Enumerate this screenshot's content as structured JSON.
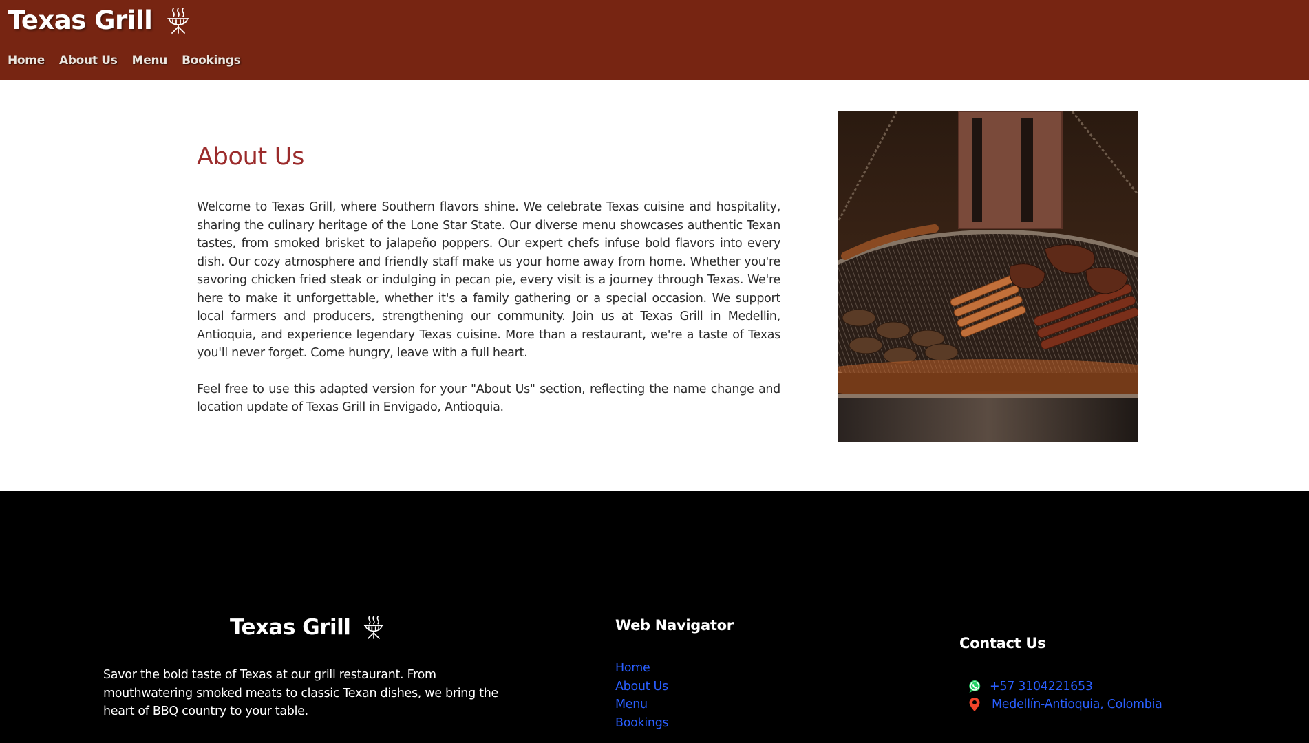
{
  "header": {
    "brand_title": "Texas Grill",
    "brand_icon": "grill-icon",
    "nav": [
      {
        "label": "Home"
      },
      {
        "label": "About Us"
      },
      {
        "label": "Menu"
      },
      {
        "label": "Bookings"
      }
    ],
    "background_color": "#772512"
  },
  "about": {
    "heading": "About Us",
    "paragraphs": [
      "Welcome to Texas Grill, where Southern flavors shine. We celebrate Texas cuisine and hospitality, sharing the culinary heritage of the Lone Star State. Our diverse menu showcases authentic Texan tastes, from smoked brisket to jalapeño poppers. Our expert chefs infuse bold flavors into every dish. Our cozy atmosphere and friendly staff make us your home away from home. Whether you're savoring chicken fried steak or indulging in pecan pie, every visit is a journey through Texas. We're here to make it unforgettable, whether it's a family gathering or a special occasion. We support local farmers and producers, strengthening our community. Join us at Texas Grill in Medellin, Antioquia, and experience legendary Texas cuisine. More than a restaurant, we're a taste of Texas you'll never forget. Come hungry, leave with a full heart.",
      "Feel free to use this adapted version for your \"About Us\" section, reflecting the name change and location update of Texas Grill in Envigado, Antioquia."
    ],
    "heading_color": "#9b2b2b"
  },
  "footer": {
    "brand_title": "Texas Grill",
    "brand_icon": "grill-icon",
    "description": "Savor the bold taste of Texas at our grill restaurant. From mouthwatering smoked meats to classic Texan dishes, we bring the heart of BBQ country to your table.",
    "nav_title": "Web Navigator",
    "nav": [
      {
        "label": "Home"
      },
      {
        "label": "About Us"
      },
      {
        "label": "Menu"
      },
      {
        "label": "Bookings"
      }
    ],
    "contact_title": "Contact Us",
    "contact": {
      "phone": "+57 3104221653",
      "phone_icon": "whatsapp-icon",
      "location": "Medellín-Antioquia, Colombia",
      "location_icon": "map-pin-icon"
    },
    "link_color": "#2a5fff"
  }
}
